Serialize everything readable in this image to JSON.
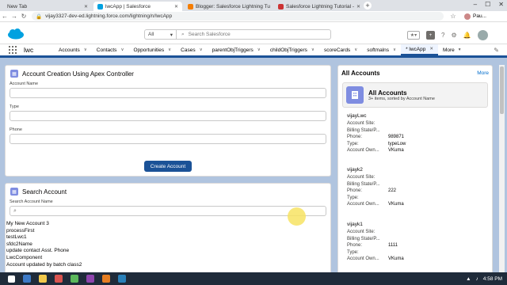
{
  "browser": {
    "tabs": [
      {
        "title": "New Tab",
        "color": "#9aa0a6"
      },
      {
        "title": "lwcApp | Salesforce",
        "color": "#00a1e0"
      },
      {
        "title": "Blogger: Salesforce Lightning Tu",
        "color": "#f57d00"
      },
      {
        "title": "Salesforce Lightning Tutorial - ",
        "color": "#c33"
      }
    ],
    "url": "vijay3327-dev-ed.lightning.force.com/lightning/n/lwcApp",
    "profile": "Pau..."
  },
  "sf": {
    "search_scope": "All",
    "search_placeholder": "Search Salesforce",
    "app_name": "lwc",
    "nav": [
      "Accounts",
      "Contacts",
      "Opportunities",
      "Cases",
      "parentObjTriggers",
      "childObjTriggers",
      "scoreCards",
      "softmalns",
      "* lwcApp",
      "More"
    ]
  },
  "create_card": {
    "title": "Account Creation Using Apex Controller",
    "account_name_label": "Account Name",
    "type_label": "Type",
    "phone_label": "Phone",
    "button": "Create Account"
  },
  "search_card": {
    "title": "Search Account",
    "label": "Search Account Name",
    "results": [
      "My New Account 3",
      "processFirst",
      "testLwc1",
      "sfdc2Name",
      "update contact Asst. Phone",
      "LwcComponent",
      "Account updated by batch class2"
    ]
  },
  "all_accounts": {
    "title": "All Accounts",
    "more": "More",
    "list_title": "All Accounts",
    "list_sub": "3+ items, sorted by Account Name",
    "records": [
      {
        "name": "vijayLwc",
        "fields": [
          [
            "Account Site:",
            ""
          ],
          [
            "Billing State/P...",
            ""
          ],
          [
            "Phone:",
            "989871"
          ],
          [
            "Type:",
            "typeLow"
          ],
          [
            "Account Own...",
            "VKuma"
          ]
        ]
      },
      {
        "name": "vijayk2",
        "fields": [
          [
            "Account Site:",
            ""
          ],
          [
            "Billing State/P...",
            ""
          ],
          [
            "Phone:",
            "222"
          ],
          [
            "Type:",
            ""
          ],
          [
            "Account Own...",
            "VKuma"
          ]
        ]
      },
      {
        "name": "vijayk1",
        "fields": [
          [
            "Account Site:",
            ""
          ],
          [
            "Billing State/P...",
            ""
          ],
          [
            "Phone:",
            "1111"
          ],
          [
            "Type:",
            ""
          ],
          [
            "Account Own...",
            "VKuma"
          ]
        ]
      }
    ]
  },
  "taskbar": {
    "time": "4:58 PM"
  }
}
